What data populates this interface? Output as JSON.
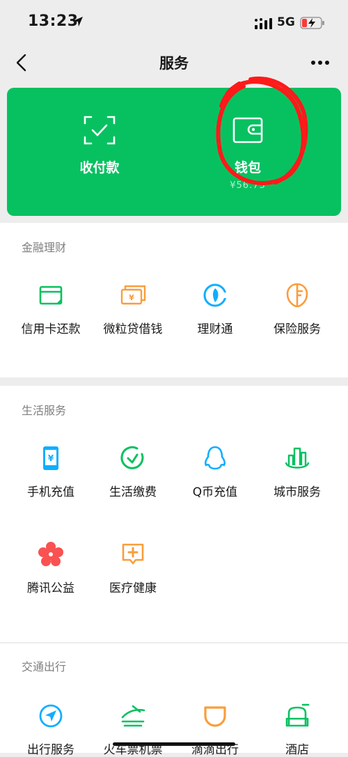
{
  "status_bar": {
    "time": "13:23",
    "network": "5G"
  },
  "nav": {
    "title": "服务"
  },
  "card": {
    "items": [
      {
        "label": "收付款",
        "icon": "scan-pay-icon"
      },
      {
        "label": "钱包",
        "sub": "¥56.73",
        "icon": "wallet-icon"
      }
    ]
  },
  "sections": [
    {
      "title": "金融理财",
      "items": [
        {
          "label": "信用卡还款",
          "icon": "credit-card-icon"
        },
        {
          "label": "微粒贷借钱",
          "icon": "loan-icon"
        },
        {
          "label": "理财通",
          "icon": "wealth-icon"
        },
        {
          "label": "保险服务",
          "icon": "insurance-icon"
        }
      ]
    },
    {
      "title": "生活服务",
      "items": [
        {
          "label": "手机充值",
          "icon": "phone-topup-icon"
        },
        {
          "label": "生活缴费",
          "icon": "utility-bill-icon"
        },
        {
          "label": "Q币充值",
          "icon": "qq-coin-icon"
        },
        {
          "label": "城市服务",
          "icon": "city-service-icon"
        },
        {
          "label": "腾讯公益",
          "icon": "charity-icon"
        },
        {
          "label": "医疗健康",
          "icon": "medical-icon"
        }
      ]
    },
    {
      "title": "交通出行",
      "items": [
        {
          "label": "出行服务",
          "icon": "travel-service-icon"
        },
        {
          "label": "火车票机票",
          "icon": "train-ticket-icon"
        },
        {
          "label": "滴滴出行",
          "icon": "didi-icon"
        },
        {
          "label": "酒店",
          "icon": "hotel-icon"
        }
      ]
    }
  ],
  "colors": {
    "green": "#07c160",
    "orange": "#fa9d3b",
    "blue": "#10aeff",
    "red": "#fa5151",
    "annotation": "#ff1a1a"
  }
}
